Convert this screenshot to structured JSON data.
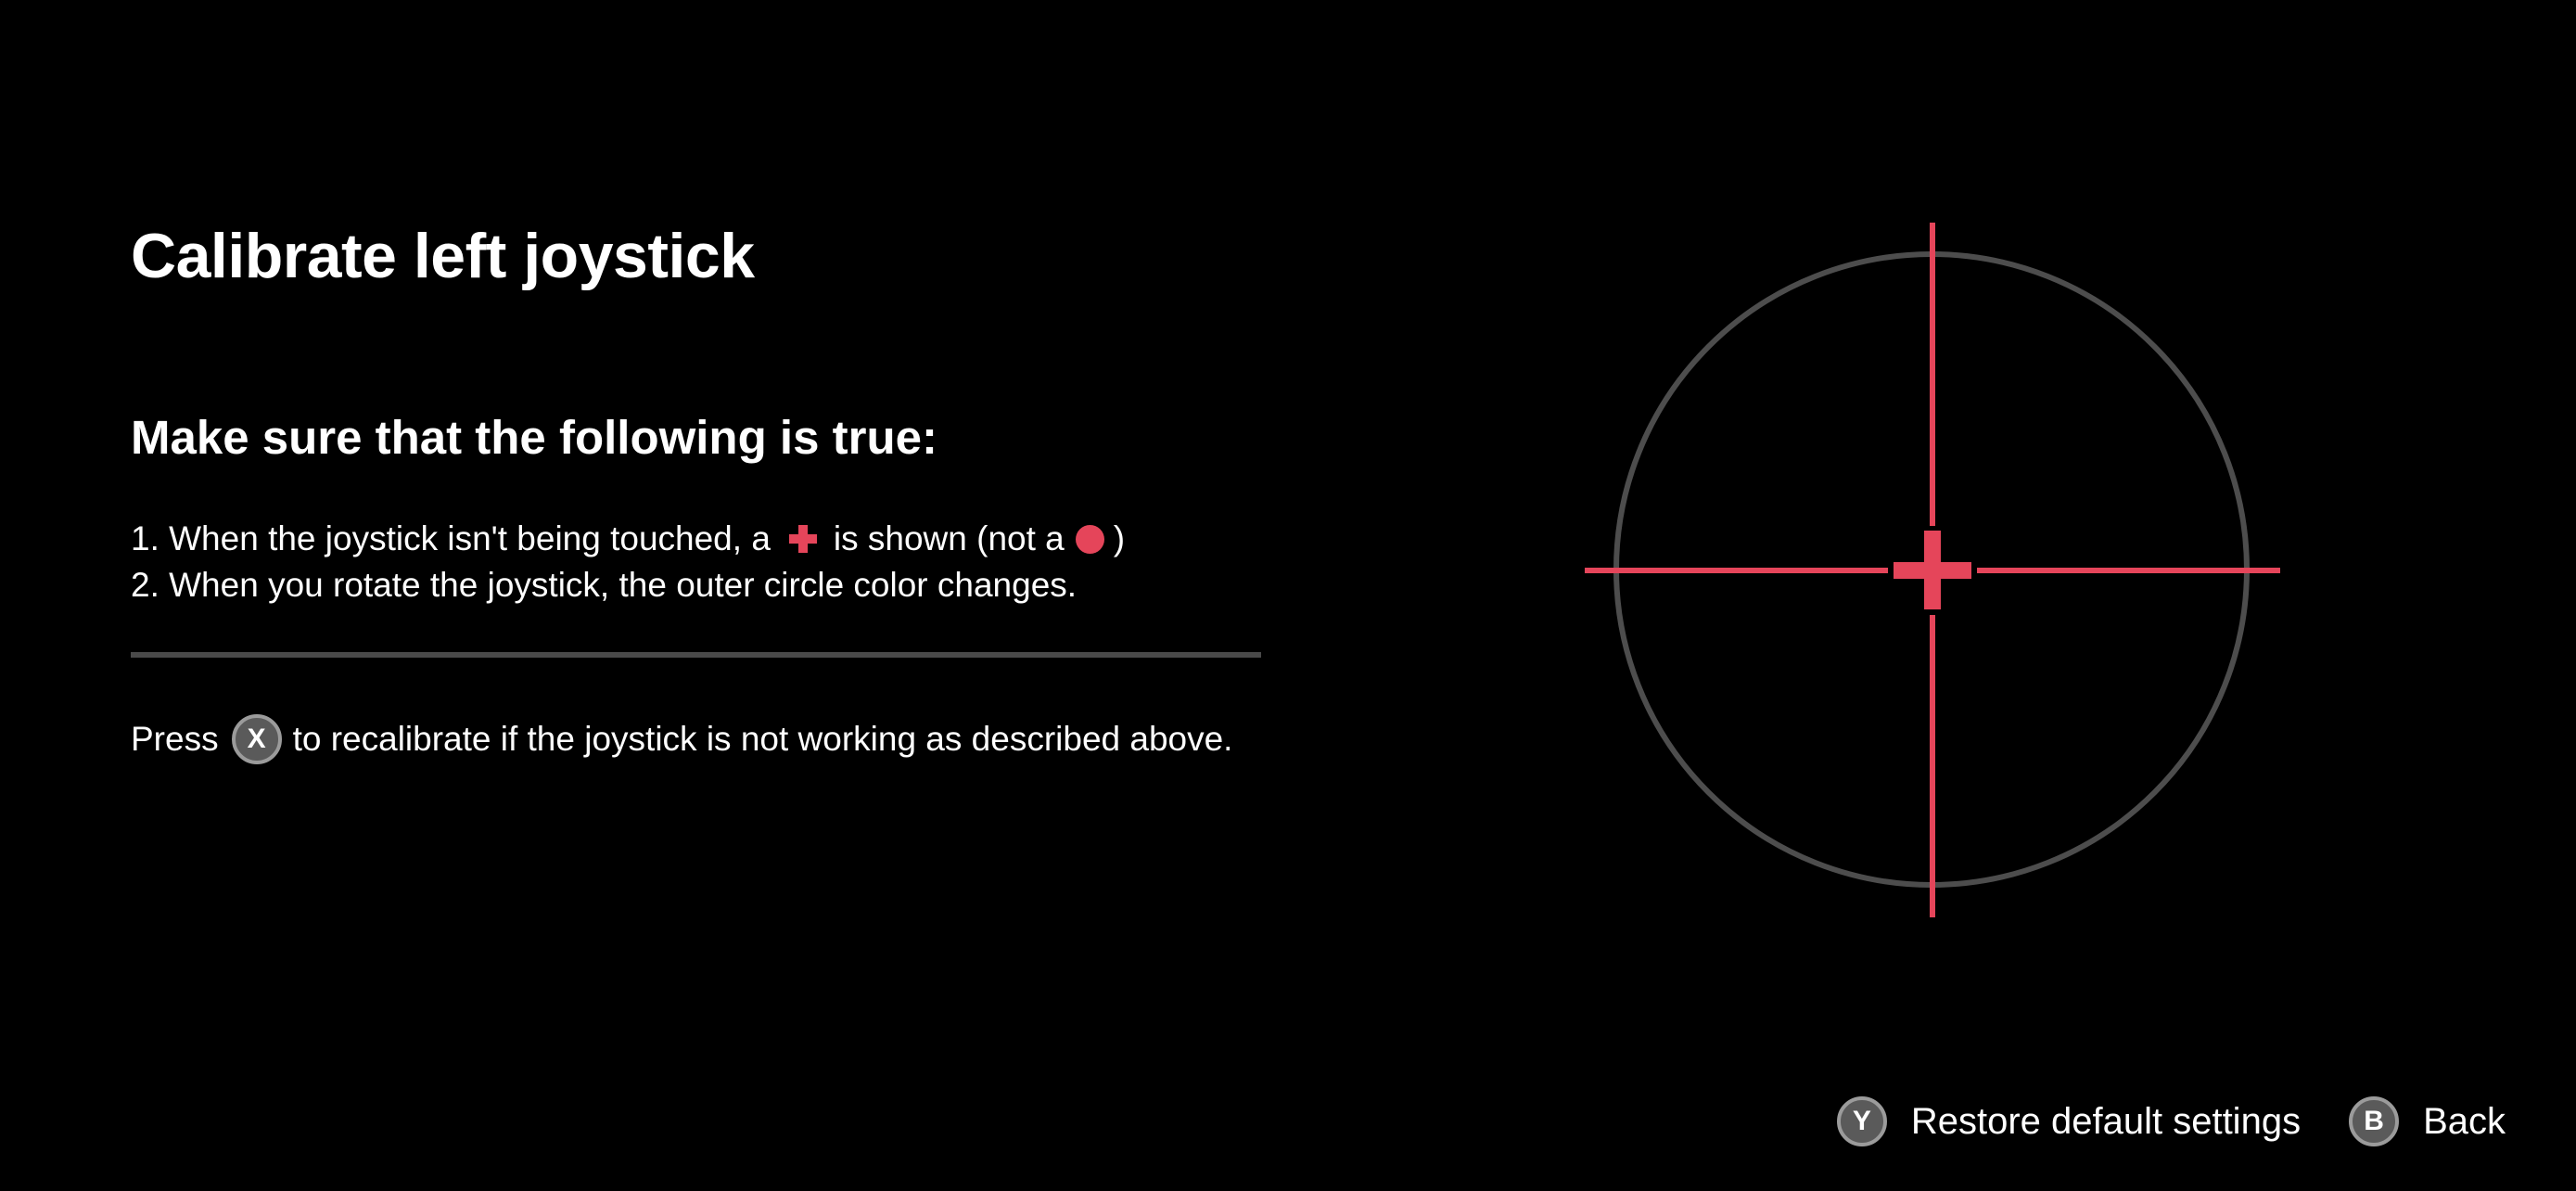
{
  "page": {
    "title": "Calibrate left joystick",
    "subheading": "Make sure that the following is true:"
  },
  "checklist": {
    "item1": {
      "before": "1. When the joystick isn't being touched, a",
      "icon_expected": "red-plus-icon",
      "middle": "is shown (not a",
      "icon_not_expected": "red-dot-icon",
      "after": ")"
    },
    "item2": {
      "text": "2. When you rotate the joystick, the outer circle color changes."
    }
  },
  "recalibrate": {
    "before": "Press",
    "button_glyph": "X",
    "after": "to recalibrate if the joystick is not working as described above."
  },
  "joystick_visual": {
    "state": "centered",
    "marker": "plus",
    "x_position": 0,
    "y_position": 0,
    "outer_circle_color": "#4d4d4d",
    "crosshair_color": "#e5455a"
  },
  "footer": {
    "restore": {
      "button_glyph": "Y",
      "label": "Restore default settings"
    },
    "back": {
      "button_glyph": "B",
      "label": "Back"
    }
  },
  "colors": {
    "accent": "#e5455a",
    "background": "#000000",
    "text": "#ffffff",
    "divider": "#4a4a4a",
    "button_fill": "#5a5a5a",
    "button_ring": "#9b9b9b"
  }
}
